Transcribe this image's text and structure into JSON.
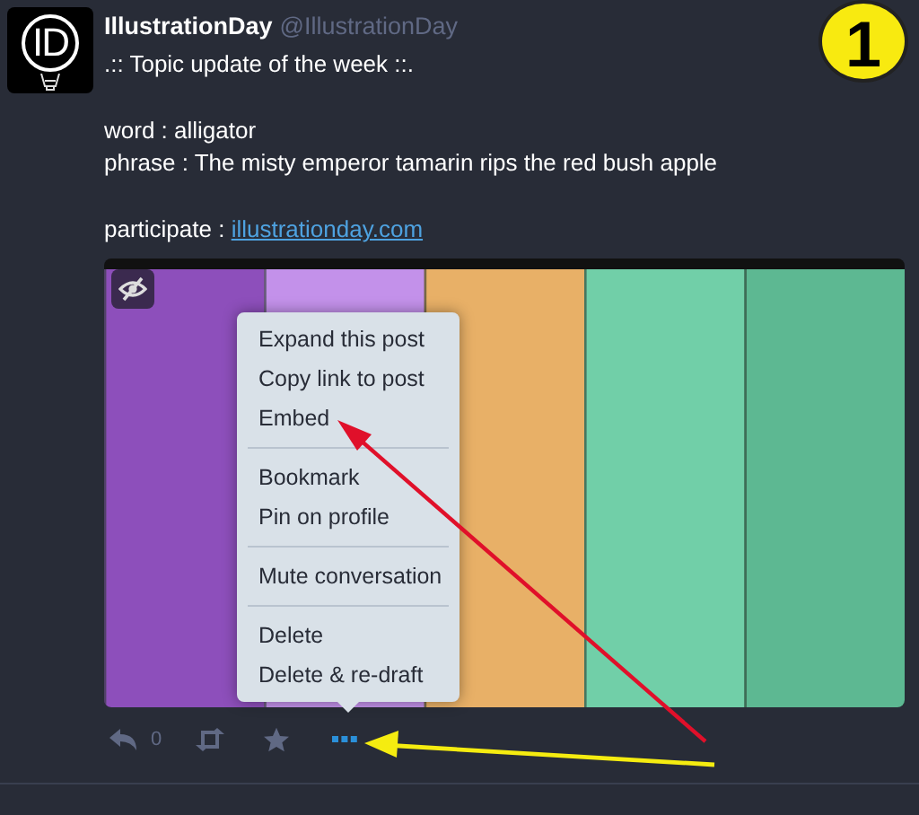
{
  "post": {
    "author": "IllustrationDay",
    "handle": "@IllustrationDay",
    "avatar_text": "ID",
    "paragraphs": [
      [
        ".:: Topic update of the week ::."
      ],
      [
        "word : alligator",
        "phrase : The misty emperor tamarin rips the red bush apple"
      ]
    ],
    "link_label": "participate : ",
    "link": "illustrationday.com",
    "media": {
      "kind": "picture"
    },
    "reply_count": "0"
  },
  "menu": {
    "groups": [
      [
        "Expand this post",
        "Copy link to post",
        "Embed"
      ],
      [
        "Bookmark",
        "Pin on profile"
      ],
      [
        "Mute conversation"
      ],
      [
        "Delete",
        "Delete & re-draft"
      ]
    ]
  },
  "badge": "1"
}
